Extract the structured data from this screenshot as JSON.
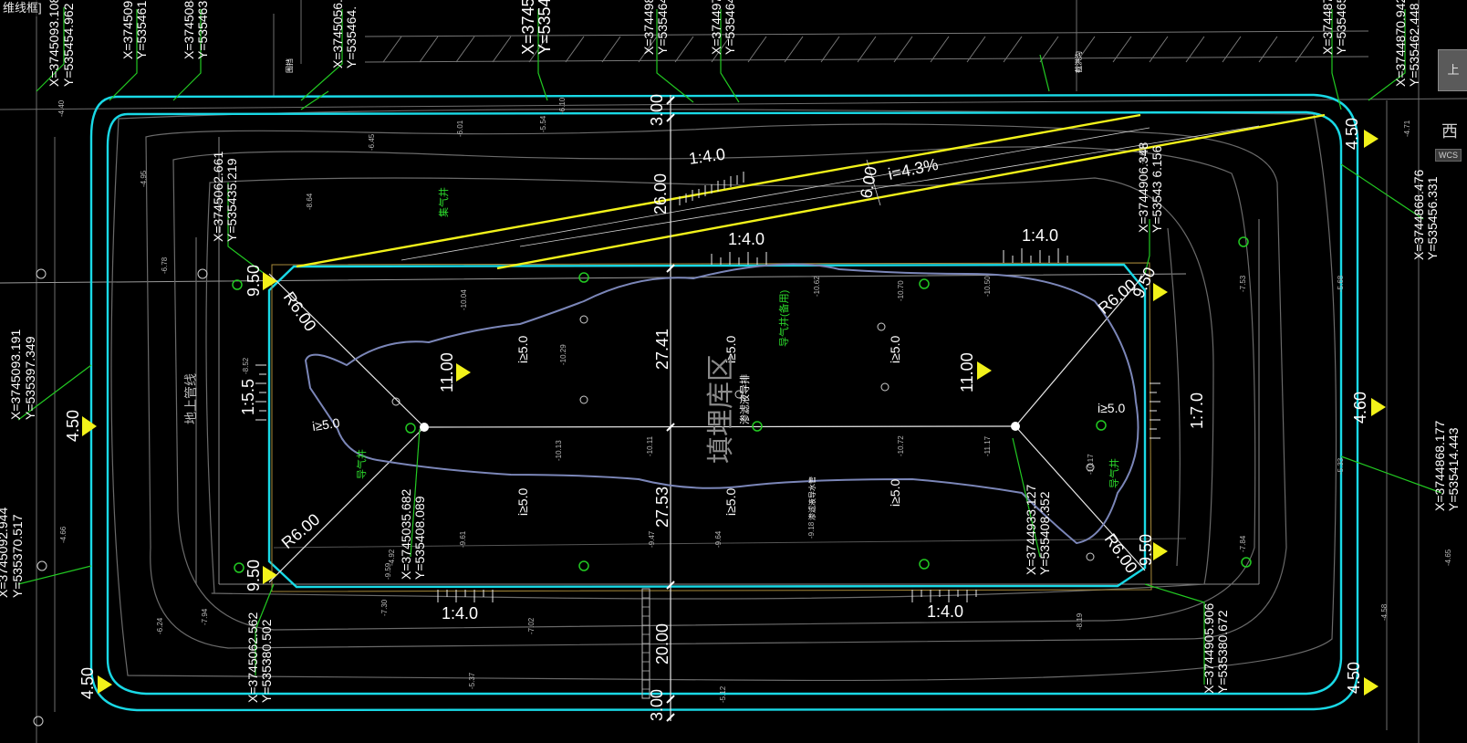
{
  "viewport_label": "维线框]",
  "nav_cube": {
    "face": "上",
    "side_label": "西",
    "wcs": "WCS"
  },
  "colors": {
    "background": "#000000",
    "boundary": "#19d9e6",
    "slope_line": "#f2f21a",
    "text": "#ffffff",
    "leader": "#22c922",
    "contour": "#7a7a7a"
  },
  "top_coords": [
    {
      "x": "X=3745093.108",
      "y": "Y=535454.962"
    },
    {
      "x": "X=3745091.",
      "y": "Y=535461."
    },
    {
      "x": "X=3745084.",
      "y": "Y=535463.8"
    },
    {
      "x": "X=3745056.",
      "y": "Y=535464."
    },
    {
      "x": "X=374501",
      "y": "Y=53546"
    },
    {
      "x": "X=3744988",
      "y": "Y=535464"
    },
    {
      "x": "X=3744979",
      "y": "Y=535464"
    },
    {
      "x": "X=374487",
      "y": "Y=535465"
    },
    {
      "x": "X=3744870.942",
      "y": "Y=535462.448"
    }
  ],
  "corner_coords": {
    "upper_left": {
      "x": "X=3745062.661",
      "y": "Y=535435.219"
    },
    "upper_right": {
      "x": "X=3744906.348",
      "y": "Y=53543 6.156"
    },
    "left": {
      "x": "X=3745093.191",
      "y": "Y=535397.349"
    },
    "right": {
      "x": "X=3744868.476",
      "y": "Y=535456.331"
    },
    "right_lower": {
      "x": "X=3744868.177",
      "y": "Y=535414.443"
    },
    "bottom_left_edge": {
      "x": "X=3745092.944",
      "y": "Y=535370.517"
    },
    "bottom_left": {
      "x": "X=3745062.562",
      "y": "Y=535380.502"
    },
    "center_left": {
      "x": "X=3745035.682",
      "y": "Y=535408.089"
    },
    "center_right": {
      "x": "X=3744933.127",
      "y": "Y=535408.352"
    },
    "bottom_right": {
      "x": "X=3744905.906",
      "y": "Y=535380.672"
    }
  },
  "elevations": {
    "outer_left": "4.50",
    "outer_right_top": "4.50",
    "outer_right_mid": "4.60",
    "outer_left_bottom": "4.50",
    "outer_right_bottom": "4.50",
    "inner_tl": "9.50",
    "inner_tr": "9.50",
    "inner_bl": "9.50",
    "inner_br": "9.50",
    "center_left": "11.00",
    "center_right": "11.00"
  },
  "dimensions": {
    "top": "3.00",
    "upper": "26.00",
    "middle_upper": "27.41",
    "middle_lower": "27.53",
    "lower": "20.00",
    "bottom": "3.00",
    "ramp_width": "6.00"
  },
  "slopes": {
    "top_left": "1:4.0",
    "top_mid": "1:4.0",
    "top_right": "1:4.0",
    "bottom_left": "1:4.0",
    "bottom_right": "1:4.0",
    "left": "1:5.5",
    "right": "1:7.0",
    "ramp": "i=4.3%",
    "grade_a": "i≥5.0",
    "grade_b": "i≥5.0",
    "grade_c": "i≥5.0",
    "grade_d": "i≥5.0",
    "grade_e": "i≥5.0",
    "grade_f": "i≥5.0",
    "grade_g": "i≥5.0",
    "grade_h": "i≥5.0"
  },
  "radii": {
    "tl": "R6.00",
    "tr": "R6.00",
    "bl": "R6.00",
    "br": "R6.00"
  },
  "labels": {
    "center_title": "填埋库区",
    "left_note": "地上管线",
    "leachate": "导气井(备用)",
    "drain": "渗滤液导排",
    "vent_a": "导气井",
    "vent_b": "导气井",
    "vent_c": "集气井",
    "pipe": "渗滤液导水管",
    "top_road_a": "围挡",
    "top_road_b": "截洪沟"
  },
  "spot_heights": [
    "-4.40",
    "-4.92",
    "-4.95",
    "-5.12",
    "-5.54",
    "-6.01",
    "-6.45",
    "-7.02",
    "-7.30",
    "-7.94",
    "-8.19",
    "-8.52",
    "-8.64",
    "-9.18",
    "-9.47",
    "-9.61",
    "-10.04",
    "-10.13",
    "-10.29",
    "-10.50",
    "-10.62",
    "-10.72",
    "-11.17",
    "-4.58",
    "-5.33",
    "-5.68",
    "-6.78",
    "-7.53",
    "-7.84",
    "-8.63",
    "-9.59",
    "-9.64",
    "-10.11",
    "-10.17",
    "-10.70",
    "-4.66",
    "-5.37",
    "-6.24",
    "-4.65",
    "-6.10",
    "-4.71"
  ]
}
